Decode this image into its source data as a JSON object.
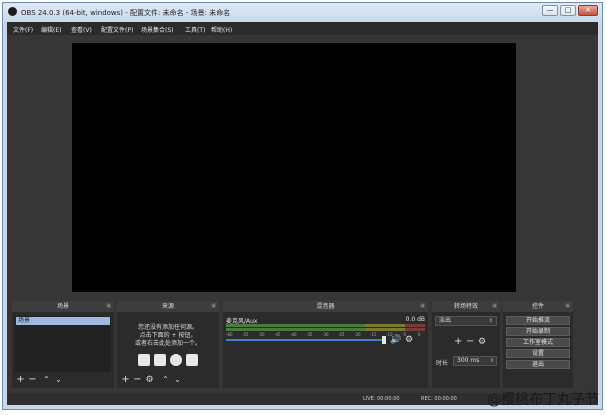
{
  "window": {
    "title": "OBS 24.0.3 (64-bit, windows) - 配置文件: 未命名 - 场景: 未命名",
    "minimize": "—",
    "maximize": "□",
    "close": "✕"
  },
  "menu": [
    "文件(F)",
    "编辑(E)",
    "查看(V)",
    "配置文件(P)",
    "场景集合(S)",
    "工具(T)",
    "帮助(H)"
  ],
  "docks": {
    "scenes": {
      "title": "场景",
      "items": [
        "场景"
      ]
    },
    "sources": {
      "title": "来源",
      "empty_line1": "您还没有添加任何源。",
      "empty_line2": "点击下面的 + 按钮，",
      "empty_line3": "或者右击此处添加一个。"
    },
    "mixer": {
      "title": "混音器",
      "track_name": "麦克风/Aux",
      "track_db": "0.0 dB",
      "tick_labels": [
        "-60",
        "-55",
        "-50",
        "-45",
        "-40",
        "-35",
        "-30",
        "-25",
        "-20",
        "-15",
        "-10",
        "-5",
        "0"
      ]
    },
    "transitions": {
      "title": "转场特效",
      "selected": "淡出",
      "duration_label": "时长",
      "duration_value": "300 ms"
    },
    "controls": {
      "title": "控件",
      "buttons": [
        "开始推流",
        "开始录制",
        "工作室模式",
        "设置",
        "退出"
      ]
    }
  },
  "status": {
    "live": "LIVE: 00:00:00",
    "rec": "REC: 00:00:00"
  },
  "watermark": "@樱桃布丁丸子节"
}
